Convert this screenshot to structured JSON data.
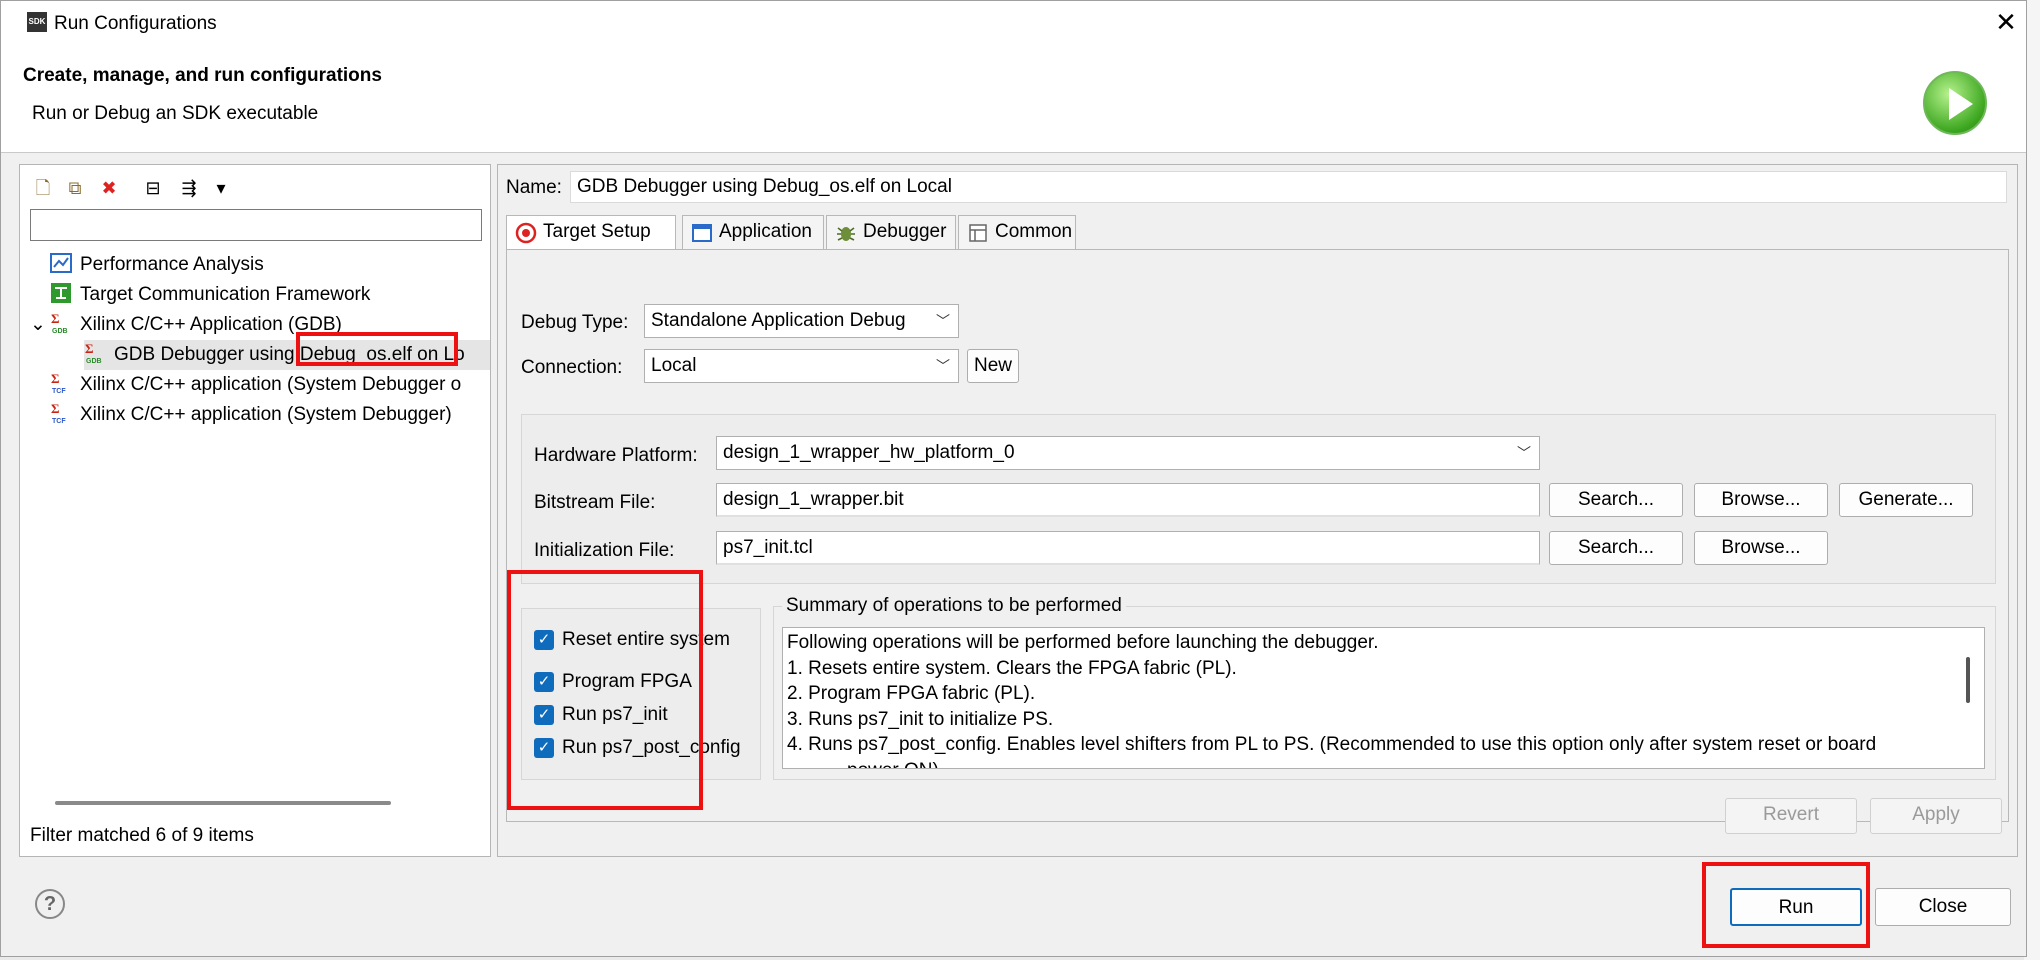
{
  "window": {
    "title": "Run Configurations",
    "app_badge": "SDK"
  },
  "header": {
    "title": "Create, manage, and run configurations",
    "subtitle": "Run or Debug an SDK executable"
  },
  "left": {
    "toolbar": [
      {
        "name": "new-config-icon",
        "glyph": "🗋"
      },
      {
        "name": "duplicate-icon",
        "glyph": "⧉"
      },
      {
        "name": "delete-icon",
        "glyph": "✖"
      },
      {
        "name": "collapse-all-icon",
        "glyph": "⊟"
      },
      {
        "name": "filter-icon",
        "glyph": "⇶"
      },
      {
        "name": "dropdown-icon",
        "glyph": "▾"
      }
    ],
    "filter_value": "",
    "tree": [
      {
        "label": "Performance Analysis",
        "level": 0,
        "icon": "chart-icon"
      },
      {
        "label": "Target Communication Framework",
        "level": 0,
        "icon": "tcf-framework-icon"
      },
      {
        "label": "Xilinx C/C++ Application (GDB)",
        "level": 0,
        "expanded": true,
        "icon": "gdb-app-icon"
      },
      {
        "label": "GDB Debugger using Debug_os.elf on Lo",
        "level": 1,
        "selected": true,
        "icon": "gdb-app-icon"
      },
      {
        "label": "Xilinx C/C++ application (System Debugger o",
        "level": 0,
        "icon": "tcf-app-icon"
      },
      {
        "label": "Xilinx C/C++ application (System Debugger)",
        "level": 0,
        "icon": "tcf-app-icon"
      }
    ],
    "status": "Filter matched 6 of 9 items"
  },
  "right": {
    "name_label": "Name:",
    "name_value": "GDB Debugger using Debug_os.elf on Local",
    "tabs": [
      {
        "label": "Target Setup",
        "icon": "target-icon",
        "active": true
      },
      {
        "label": "Application",
        "icon": "application-icon"
      },
      {
        "label": "Debugger",
        "icon": "debugger-icon"
      },
      {
        "label": "Common",
        "icon": "common-icon"
      }
    ],
    "debug_type_label": "Debug Type:",
    "debug_type_value": "Standalone Application Debug",
    "connection_label": "Connection:",
    "connection_value": "Local",
    "new_button": "New",
    "hardware_platform_label": "Hardware Platform:",
    "hardware_platform_value": "design_1_wrapper_hw_platform_0",
    "bitstream_label": "Bitstream File:",
    "bitstream_value": "design_1_wrapper.bit",
    "init_label": "Initialization File:",
    "init_value": "ps7_init.tcl",
    "search_button": "Search...",
    "browse_button": "Browse...",
    "generate_button": "Generate...",
    "checkboxes": [
      {
        "label": "Reset entire system",
        "checked": true
      },
      {
        "label": "Program FPGA",
        "checked": true
      },
      {
        "label": "Run ps7_init",
        "checked": true
      },
      {
        "label": "Run ps7_post_config",
        "checked": true
      }
    ],
    "summary_title": "Summary of operations to be performed",
    "summary_lines": [
      "Following operations will be performed before launching the debugger.",
      "1. Resets entire system. Clears the FPGA fabric (PL).",
      "2. Program FPGA fabric (PL).",
      "3. Runs ps7_init to initialize PS.",
      "4. Runs ps7_post_config. Enables level shifters from PL to PS. (Recommended to use this option only after system reset or board",
      "power ON)"
    ],
    "revert_button": "Revert",
    "apply_button": "Apply"
  },
  "footer": {
    "help": "?",
    "run_button": "Run",
    "close_button": "Close"
  },
  "colors": {
    "highlight": "#ee1111",
    "checkbox": "#0f6cbd"
  }
}
